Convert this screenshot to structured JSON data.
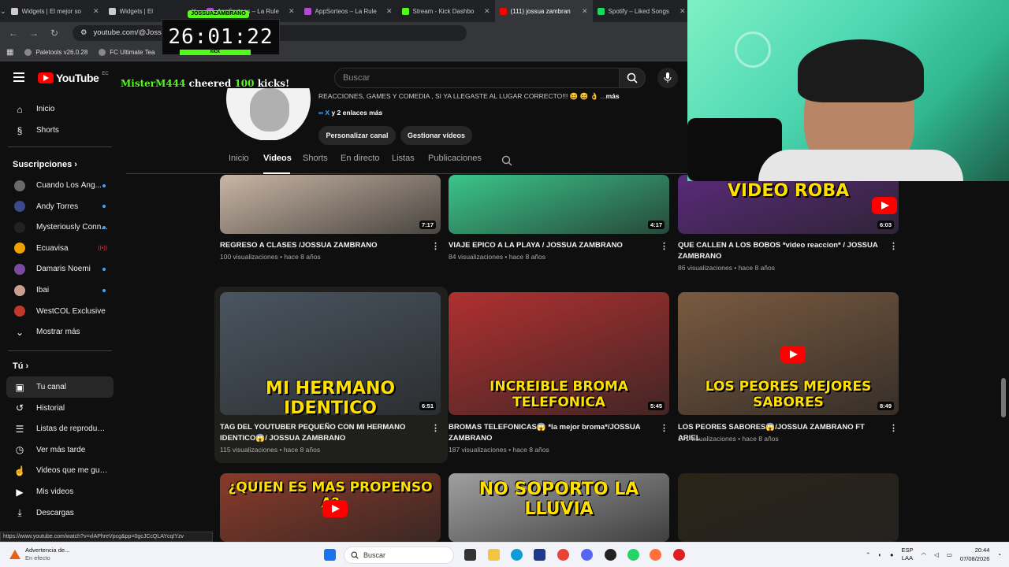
{
  "browser": {
    "tabs": [
      {
        "title": "Widgets | El mejor so",
        "color": "#cccccc"
      },
      {
        "title": "Widgets | El",
        "color": "#cccccc"
      },
      {
        "title": "AppSorteos – La Rule",
        "color": "#b14bd1"
      },
      {
        "title": "AppSorteos – La Rule",
        "color": "#b14bd1"
      },
      {
        "title": "Stream - Kick Dashbo",
        "color": "#53fc18"
      },
      {
        "title": "(111) jossua zambran",
        "color": "#ff0000"
      },
      {
        "title": "Spotify – Liked Songs",
        "color": "#1ed760"
      }
    ],
    "url": "youtube.com/@Jossu",
    "bookmarks": [
      "Paletools v26.0.28",
      "FC Ultimate Tea"
    ]
  },
  "overlay": {
    "timer_label": "JOSSUAZAMBRANO",
    "timer": "26:01:22",
    "timer_brand": "KICK",
    "cheer_user": "MisterM444",
    "cheer_text": " cheered ",
    "cheer_amount": "100",
    "cheer_suffix": " kicks!"
  },
  "youtube": {
    "logo": "YouTube",
    "logo_country": "EC",
    "search_placeholder": "Buscar"
  },
  "sidebar": {
    "main": [
      {
        "label": "Inicio",
        "icon": "home-icon"
      },
      {
        "label": "Shorts",
        "icon": "shorts-icon"
      }
    ],
    "subs_header": "Suscripciones",
    "subs": [
      {
        "label": "Cuando Los Áng...",
        "color": "#6a6a6a",
        "badge": "dot"
      },
      {
        "label": "Andy Torres",
        "color": "#3a4a8a",
        "badge": "dot"
      },
      {
        "label": "Mysteriously Conn...",
        "color": "#222222",
        "badge": "dot"
      },
      {
        "label": "Ecuavisa",
        "color": "#f0a000",
        "badge": "live"
      },
      {
        "label": "Damaris Noemi",
        "color": "#7a4aa0",
        "badge": "dot"
      },
      {
        "label": "Ibai",
        "color": "#c9a090",
        "badge": "dot"
      },
      {
        "label": "WestCOL Exclusive",
        "color": "#c0392b",
        "badge": "none"
      }
    ],
    "show_more": "Mostrar más",
    "you_header": "Tú",
    "you": [
      {
        "label": "Tu canal",
        "icon": "channel-icon"
      },
      {
        "label": "Historial",
        "icon": "history-icon"
      },
      {
        "label": "Listas de reproducc...",
        "icon": "playlists-icon"
      },
      {
        "label": "Ver más tarde",
        "icon": "watch-later-icon"
      },
      {
        "label": "Videos que me gus...",
        "icon": "like-icon"
      },
      {
        "label": "Mis videos",
        "icon": "my-videos-icon"
      },
      {
        "label": "Descargas",
        "icon": "downloads-icon"
      }
    ]
  },
  "channel": {
    "description": "REACCIONES, GAMES Y COMEDIA , SI YA LLEGASTE AL LUGAR CORRECTO!!! 😆 😆 👌 ...",
    "more": "más",
    "links_x": "X",
    "links_more": "y 2 enlaces más",
    "btn_customize": "Personalizar canal",
    "btn_manage": "Gestionar vídeos",
    "tabs": [
      "Inicio",
      "Videos",
      "Shorts",
      "En directo",
      "Listas",
      "Publicaciones"
    ],
    "active_tab": "Videos"
  },
  "videos": [
    {
      "title": "REGRESO A CLASES /JOSSUA ZAMBRANO",
      "views": "100 visualizaciones",
      "age": "hace 8 años",
      "duration": "7:17",
      "thumb_text": "",
      "bg": "#c9b6a5"
    },
    {
      "title": "VIAJE EPICO A LA PLAYA / JOSSUA ZAMBRANO",
      "views": "84 visualizaciones",
      "age": "hace 8 años",
      "duration": "4:17",
      "thumb_text": "",
      "bg": "#3ac68a"
    },
    {
      "title": "QUE CALLEN A LOS BOBOS *video reaccion* / JOSSUA ZAMBRANO",
      "views": "86 visualizaciones",
      "age": "hace 8 años",
      "duration": "6:03",
      "thumb_text": "VIDEO ROBA",
      "bg": "#5a2a7a"
    },
    {
      "title": "TAG DEL YOUTUBER PEQUEÑO CON MI HERMANO IDENTICO😱/ JOSSUA ZAMBRANO",
      "views": "115 visualizaciones",
      "age": "hace 8 años",
      "duration": "6:51",
      "thumb_text": "MI HERMANO IDENTICO",
      "bg": "#4a5560"
    },
    {
      "title": "BROMAS TELEFONICAS😱 *la mejor broma*/JOSSUA ZAMBRANO",
      "views": "187 visualizaciones",
      "age": "hace 8 años",
      "duration": "5:45",
      "thumb_text": "INCREIBLE BROMA TELEFONICA",
      "bg": "#b03030"
    },
    {
      "title": "LOS PEORES SABORES😱/JOSSUA ZAMBRANO FT ARIEL",
      "views": "171 visualizaciones",
      "age": "hace 8 años",
      "duration": "8:49",
      "thumb_text": "LOS PEORES MEJORES SABORES",
      "bg": "#7a5a40"
    },
    {
      "title": "",
      "views": "",
      "age": "",
      "duration": "",
      "thumb_text": "¿QUIEN ES MAS PROPENSO A?",
      "bg": "#8a3a2a"
    },
    {
      "title": "",
      "views": "",
      "age": "",
      "duration": "",
      "thumb_text": "NO SOPORTO LA LLUVIA",
      "bg": "#a0a0a0"
    },
    {
      "title": "",
      "views": "",
      "age": "",
      "duration": "",
      "thumb_text": "",
      "bg": "#2a2418"
    }
  ],
  "status_url": "https://www.youtube.com/watch?v=vlAPhreVpcg&pp=0gcJCcQLAYcqIYzv",
  "taskbar": {
    "warning_title": "Advertencia de...",
    "warning_sub": "En efecto",
    "search": "Buscar",
    "lang": "ESP",
    "lang_sub": "LAA",
    "time": "20:44",
    "date": "07/08/2026"
  }
}
